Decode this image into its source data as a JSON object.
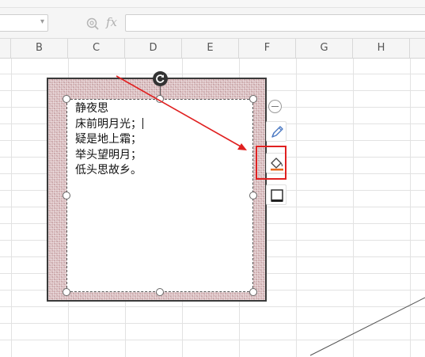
{
  "formula_bar": {
    "name_box_value": "",
    "fx_label": "fx",
    "formula_value": "",
    "icons": [
      "zoom-icon",
      "fx-icon",
      "chevron-down-icon"
    ]
  },
  "columns": [
    "B",
    "C",
    "D",
    "E",
    "F",
    "G",
    "H"
  ],
  "textbox": {
    "lines": [
      "静夜思",
      "床前明月光；",
      "疑是地上霜；",
      "举头望明月；",
      "低头思故乡。"
    ]
  },
  "side_tools": {
    "icons": [
      "collapse-icon",
      "pen-icon",
      "fill-bucket-icon",
      "border-icon"
    ]
  },
  "colors": {
    "shape_fill": "#d5b6b8",
    "annotation_red": "#e02020"
  }
}
